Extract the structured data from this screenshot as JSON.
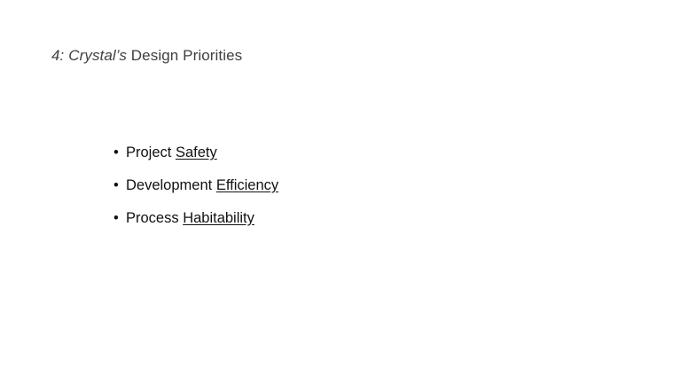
{
  "slide": {
    "title": {
      "prefix_italic": "4: Crystal’s",
      "rest": " Design Priorities"
    },
    "bullets": [
      {
        "marker": "•",
        "plain": "Project ",
        "emphasis": "Safety"
      },
      {
        "marker": "•",
        "plain": "Development ",
        "emphasis": "Efficiency"
      },
      {
        "marker": "•",
        "plain": "Process ",
        "emphasis": "Habitability"
      }
    ]
  }
}
